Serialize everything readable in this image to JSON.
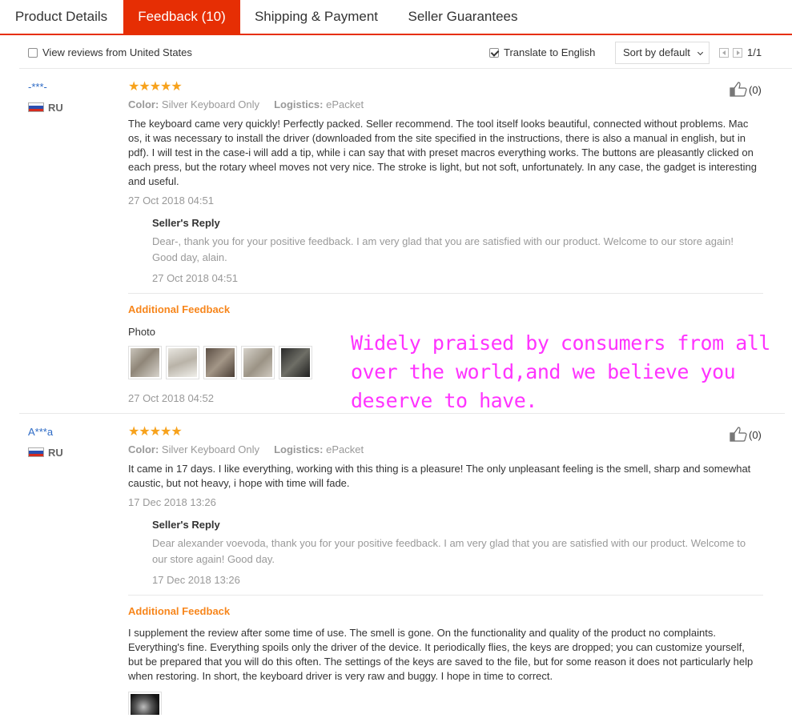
{
  "tabs": [
    {
      "label": "Product Details"
    },
    {
      "label": "Feedback (10)"
    },
    {
      "label": "Shipping & Payment"
    },
    {
      "label": "Seller Guarantees"
    }
  ],
  "filter": {
    "us_only_label": "View reviews from United States",
    "translate_label": "Translate to English",
    "sort_label": "Sort by default",
    "page_text": "1/1"
  },
  "reviews": [
    {
      "user": "-***-",
      "country": "RU",
      "stars": 5,
      "color_key": "Color:",
      "color_value": "Silver Keyboard Only",
      "logistics_key": "Logistics:",
      "logistics_value": "ePacket",
      "likes": "(0)",
      "text": "The keyboard came very quickly! Perfectly packed. Seller recommend. The tool itself looks beautiful, connected without problems. Mac os, it was necessary to install the driver (downloaded from the site specified in the instructions, there is also a manual in english, but in pdf). I will test in the case-i will add a tip, while i can say that with preset macros everything works. The buttons are pleasantly clicked on each press, but the rotary wheel moves not very nice. The stroke is light, but not soft, unfortunately. In any case, the gadget is interesting and useful.",
      "date": "27 Oct 2018 04:51",
      "reply_title": "Seller's Reply",
      "reply_text": "Dear-, thank you for your positive feedback. I am very glad that you are satisfied with our product. Welcome to our store again! Good day, alain.",
      "reply_date": "27 Oct 2018 04:51",
      "additional_title": "Additional Feedback",
      "photo_label": "Photo",
      "additional_date": "27 Oct 2018 04:52"
    },
    {
      "user": "A***a",
      "country": "RU",
      "stars": 5,
      "color_key": "Color:",
      "color_value": "Silver Keyboard Only",
      "logistics_key": "Logistics:",
      "logistics_value": "ePacket",
      "likes": "(0)",
      "text": "It came in 17 days. I like everything, working with this thing is a pleasure! The only unpleasant feeling is the smell, sharp and somewhat caustic, but not heavy, i hope with time will fade.",
      "date": "17 Dec 2018 13:26",
      "reply_title": "Seller's Reply",
      "reply_text": "Dear alexander voevoda, thank you for your positive feedback. I am very glad that you are satisfied with our product. Welcome to our store again! Good day.",
      "reply_date": "17 Dec 2018 13:26",
      "additional_title": "Additional Feedback",
      "additional_text": "I supplement the review after some time of use. The smell is gone. On the functionality and quality of the product no complaints. Everything's fine. Everything spoils only the driver of the device. It periodically flies, the keys are dropped; you can customize yourself, but be prepared that you will do this often. The settings of the keys are saved to the file, but for some reason it does not particularly help when restoring. In short, the keyboard driver is very raw and buggy. I hope in time to correct."
    }
  ],
  "promo_text": "Widely praised by consumers from all\nover the world,and we believe you\ndeserve to have.",
  "colors": {
    "accent": "#e62e04",
    "star": "#f7a21c",
    "additional": "#f7861c",
    "username": "#2e6bc6",
    "promo": "#ff33ff"
  }
}
